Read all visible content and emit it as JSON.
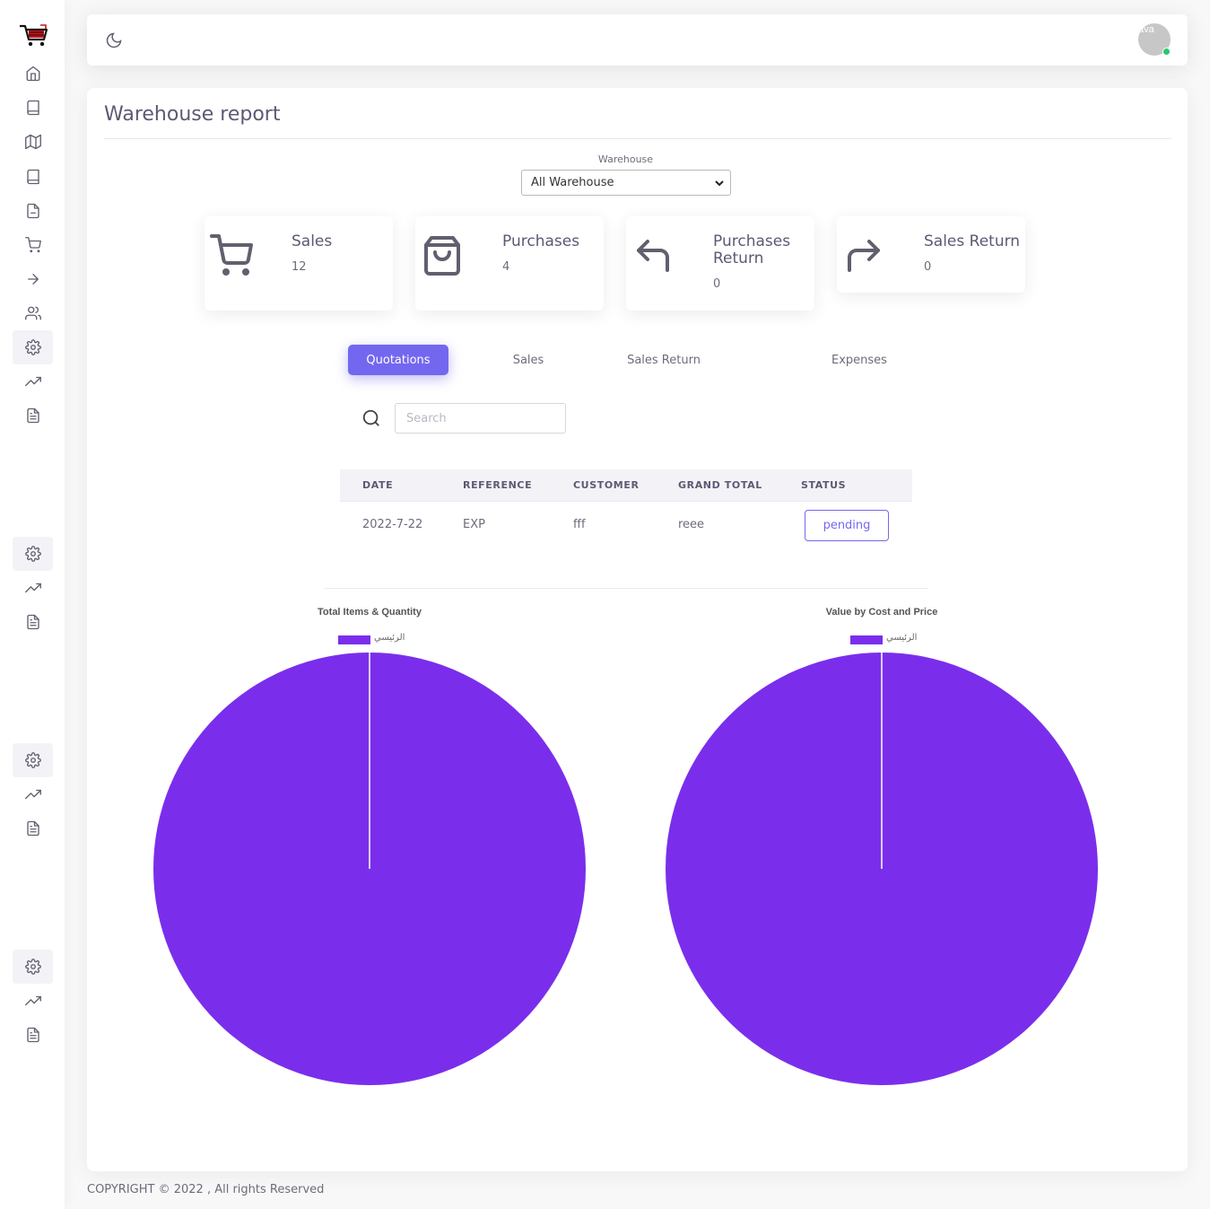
{
  "sidebar": {
    "logo": "cart-logo-icon",
    "icons": [
      "home-icon",
      "book-icon",
      "map-icon",
      "book-icon",
      "file-icon",
      "cart-icon",
      "arrow-right-icon",
      "users-icon",
      "settings-icon",
      "trending-up-icon",
      "file-text-icon"
    ]
  },
  "header": {
    "theme_icon": "moon-icon",
    "avatar_alt": "ava"
  },
  "page": {
    "title": "Warehouse report",
    "warehouse_label": "Warehouse",
    "warehouse_selected": "All Warehouse"
  },
  "stats": [
    {
      "label": "Sales",
      "value": "12",
      "icon": "cart-icon"
    },
    {
      "label": "Purchases",
      "value": "4",
      "icon": "shopping-bag-icon"
    },
    {
      "label": "Purchases Return",
      "value": "0",
      "icon": "corner-up-left-icon"
    },
    {
      "label": "Sales Return",
      "value": "0",
      "icon": "corner-up-right-icon"
    }
  ],
  "tabs": [
    {
      "label": "Quotations",
      "active": true
    },
    {
      "label": "Sales",
      "active": false
    },
    {
      "label": "Sales Return",
      "active": false
    },
    {
      "label": "Expenses",
      "active": false
    }
  ],
  "search": {
    "placeholder": "Search"
  },
  "table": {
    "headers": [
      "DATE",
      "REFERENCE",
      "CUSTOMER",
      "GRAND TOTAL",
      "STATUS"
    ],
    "rows": [
      {
        "date": "2022-7-22",
        "reference": "EXP",
        "customer": "fff",
        "grand_total": "reee",
        "status": "pending"
      }
    ]
  },
  "chart_data": [
    {
      "type": "pie",
      "title": "Total Items & Quantity",
      "legend": [
        "الرئيسي"
      ],
      "values": [
        1
      ],
      "colors": [
        "#7a2eec"
      ]
    },
    {
      "type": "pie",
      "title": "Value by Cost and Price",
      "legend": [
        "الرئيسي"
      ],
      "values": [
        1
      ],
      "colors": [
        "#7a2eec"
      ]
    }
  ],
  "footer": {
    "copyright": "COPYRIGHT © 2022 , All rights Reserved"
  }
}
